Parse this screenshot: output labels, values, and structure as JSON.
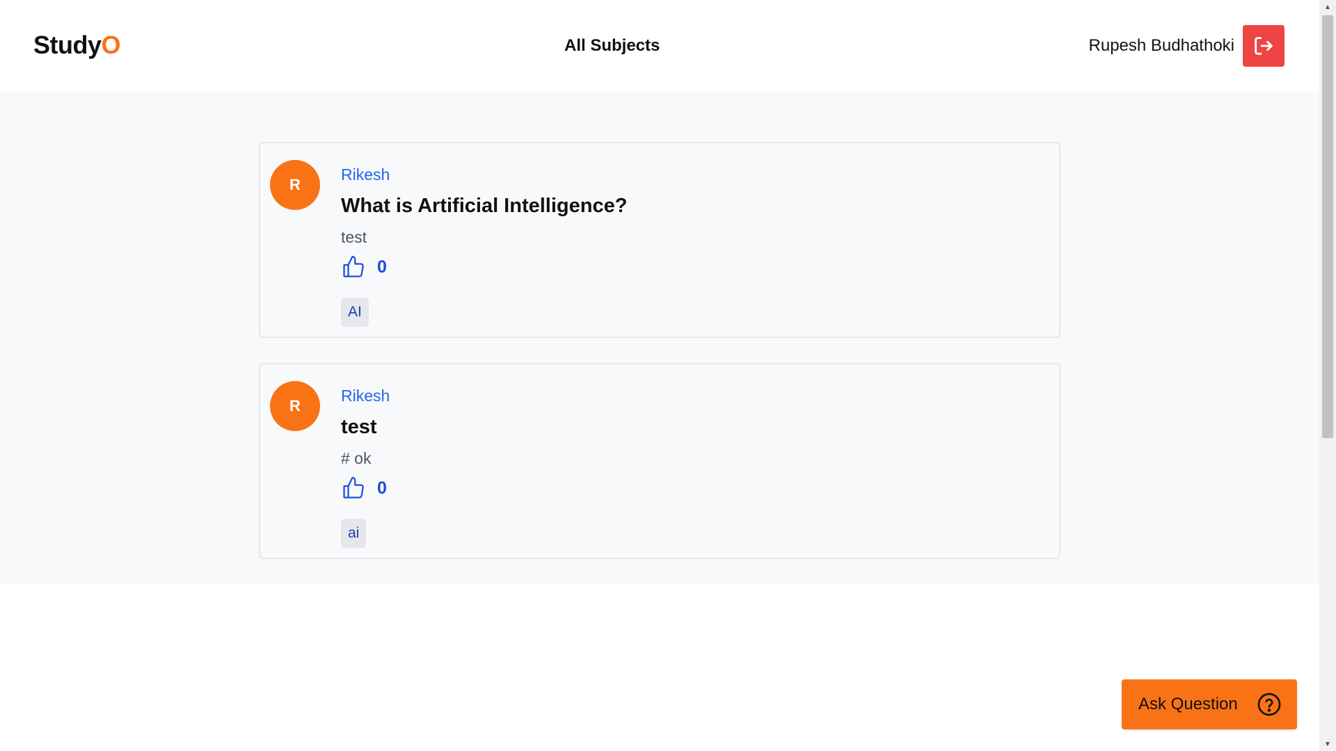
{
  "header": {
    "logo_text": "Study",
    "logo_accent": "O",
    "nav_link": "All Subjects",
    "username": "Rupesh Budhathoki",
    "logout_icon": "logout-icon"
  },
  "questions": [
    {
      "avatar_initial": "R",
      "author": "Rikesh",
      "title": "What is Artificial Intelligence?",
      "body": "test",
      "likes": "0",
      "tag": "AI"
    },
    {
      "avatar_initial": "R",
      "author": "Rikesh",
      "title": "test",
      "body": "# ok",
      "likes": "0",
      "tag": "ai"
    }
  ],
  "ask_button": {
    "label": "Ask Question",
    "icon": "question-circle-icon"
  },
  "colors": {
    "brand": "#f97316",
    "logout": "#ef4444",
    "link": "#2563eb"
  }
}
